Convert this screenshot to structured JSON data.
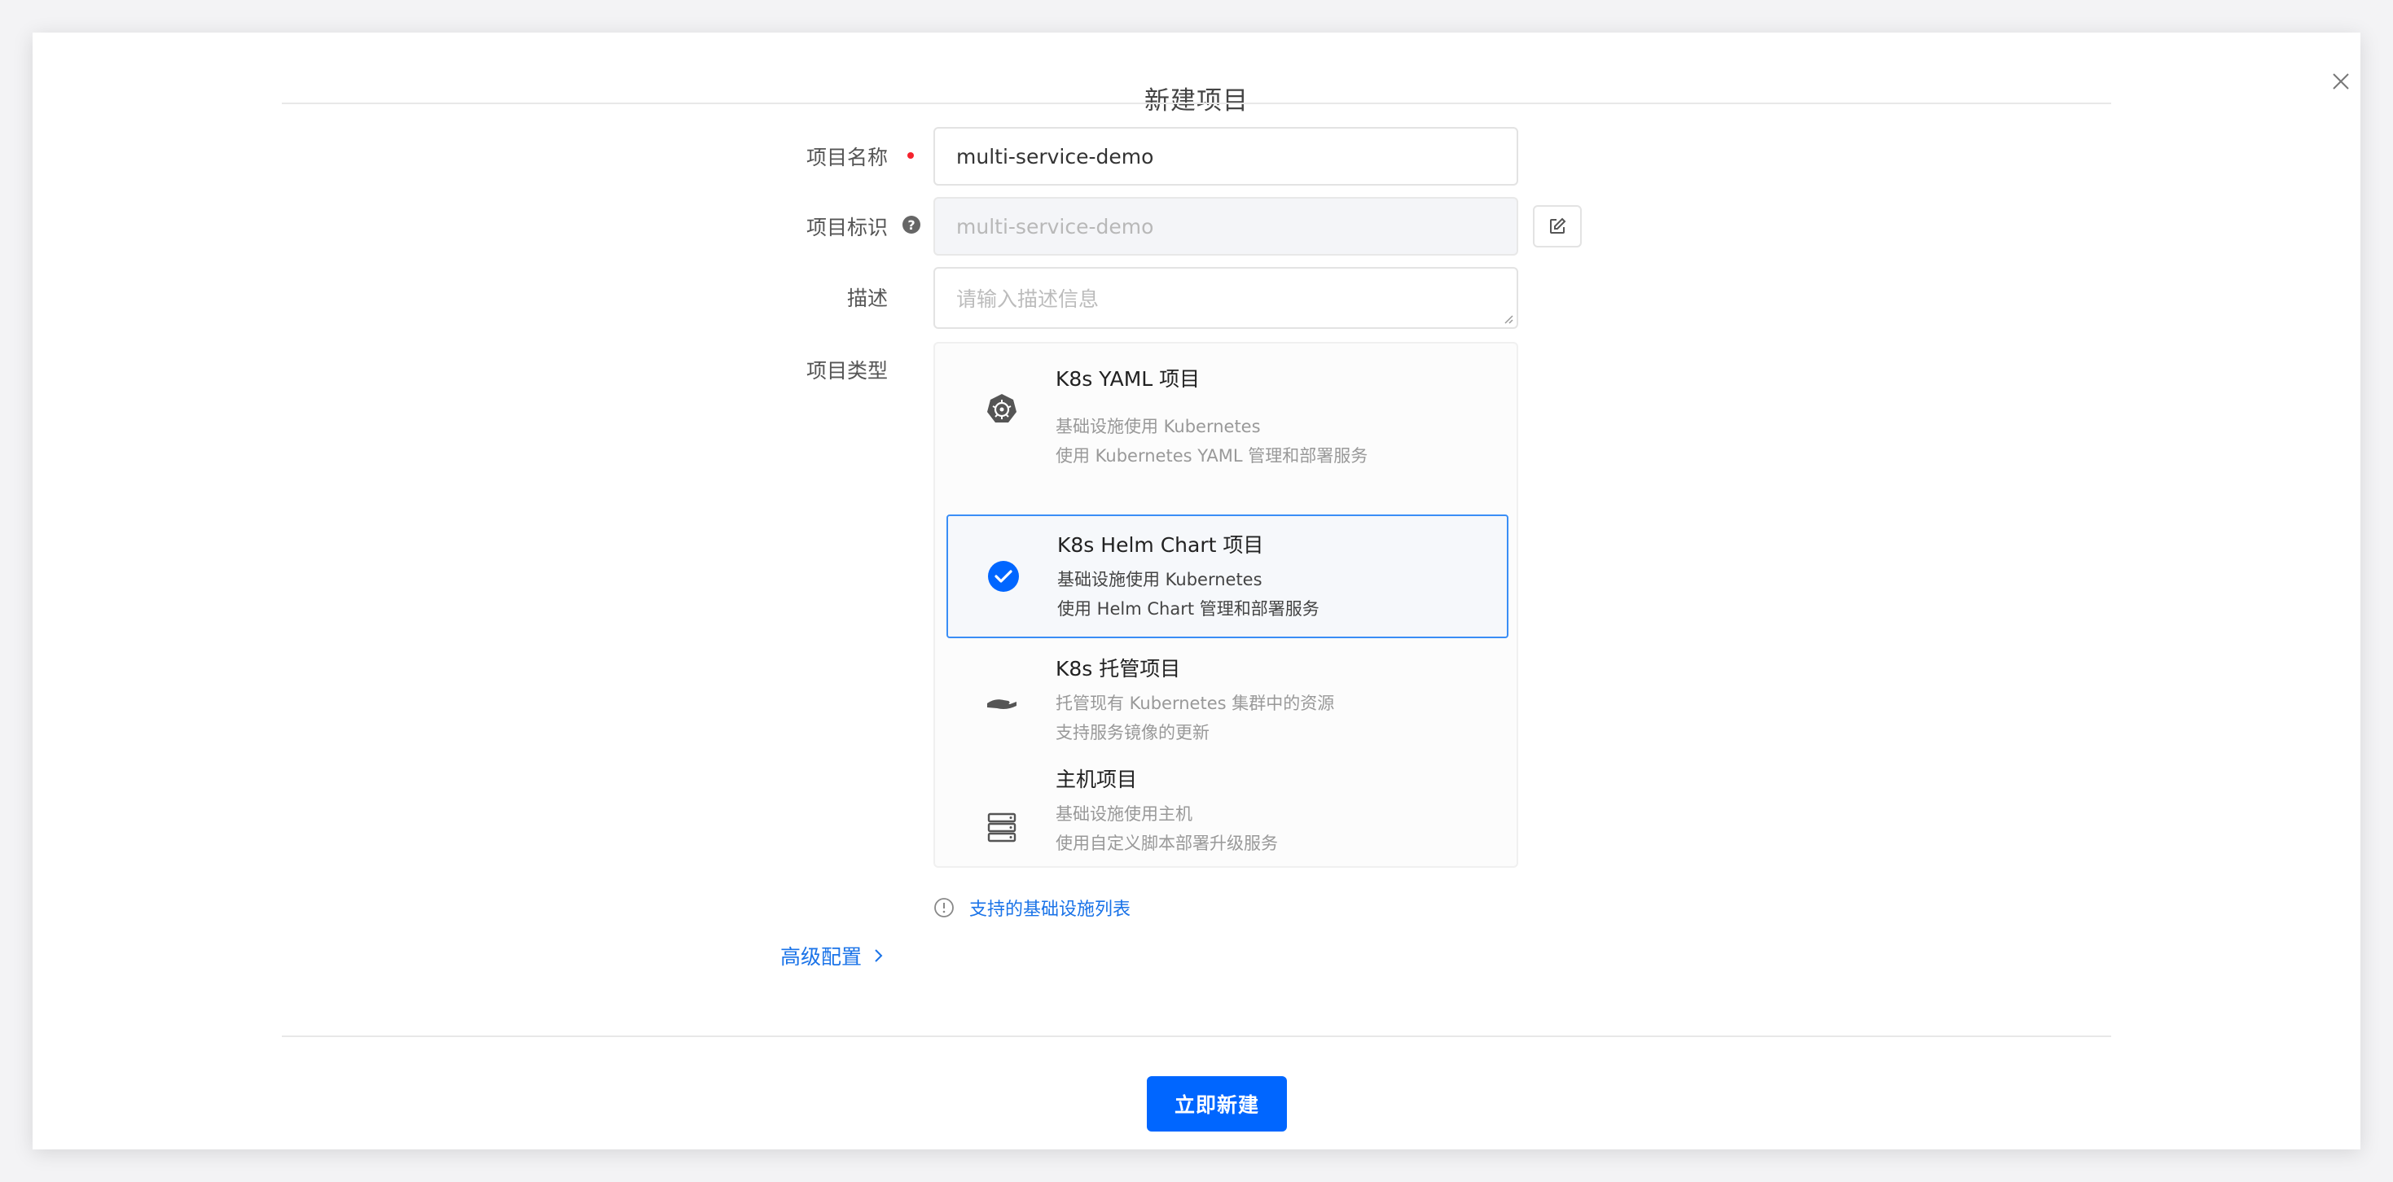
{
  "modal": {
    "title": "新建项目",
    "close_icon": "close-icon"
  },
  "form": {
    "name": {
      "label": "项目名称",
      "value": "multi-service-demo",
      "required": true
    },
    "identifier": {
      "label": "项目标识",
      "value": "multi-service-demo",
      "help_icon": "question-circle-icon",
      "edit_icon": "edit-icon"
    },
    "description": {
      "label": "描述",
      "placeholder": "请输入描述信息"
    },
    "project_type": {
      "label": "项目类型",
      "options": [
        {
          "title": "K8s YAML 项目",
          "desc1": "基础设施使用 Kubernetes",
          "desc2": "使用 Kubernetes YAML 管理和部署服务",
          "icon": "kubernetes-icon",
          "selected": false
        },
        {
          "title": "K8s Helm Chart 项目",
          "desc1": "基础设施使用 Kubernetes",
          "desc2": "使用 Helm Chart 管理和部署服务",
          "icon": "check-circle-icon",
          "selected": true
        },
        {
          "title": "K8s 托管项目",
          "desc1": "托管现有 Kubernetes 集群中的资源",
          "desc2": "支持服务镜像的更新",
          "icon": "hand-icon",
          "selected": false
        },
        {
          "title": "主机项目",
          "desc1": "基础设施使用主机",
          "desc2": "使用自定义脚本部署升级服务",
          "icon": "server-icon",
          "selected": false
        }
      ]
    },
    "support_link": "支持的基础设施列表",
    "advanced_label": "高级配置"
  },
  "footer": {
    "submit_label": "立即新建"
  },
  "colors": {
    "accent": "#0066ff",
    "selected_border": "#3a8ef6",
    "required": "#f5222d"
  }
}
